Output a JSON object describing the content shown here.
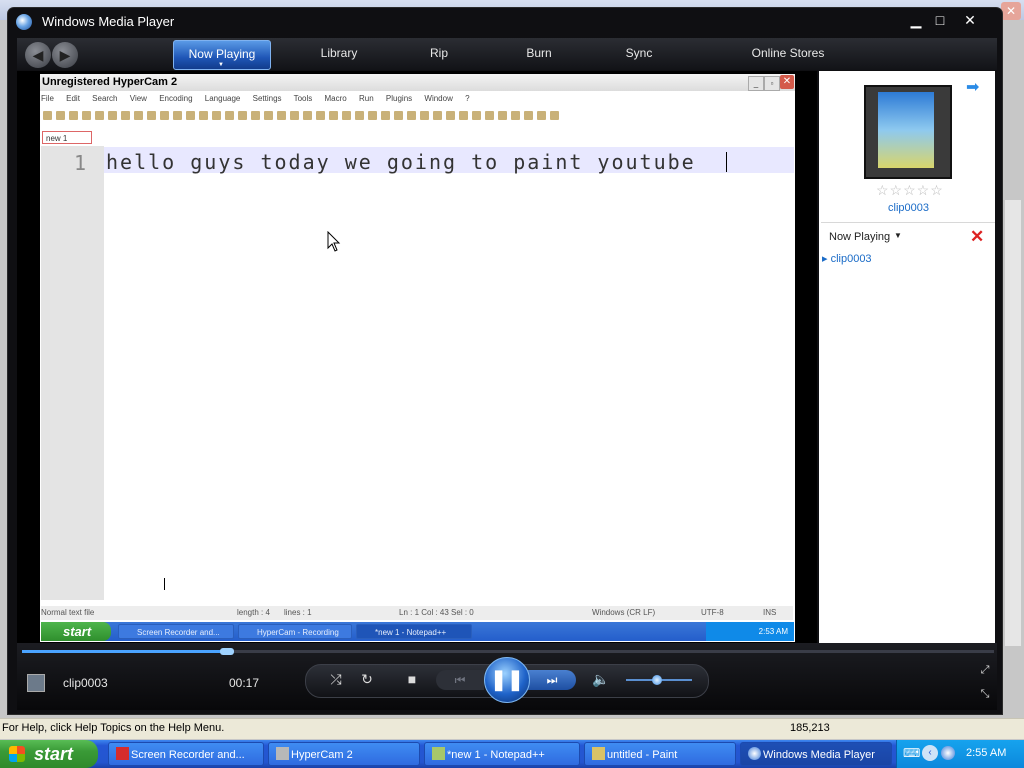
{
  "wmp": {
    "title": "Windows Media Player",
    "tabs": [
      "Now Playing",
      "Library",
      "Rip",
      "Burn",
      "Sync",
      "Online Stores"
    ]
  },
  "capture": {
    "window_title": "Unregistered HyperCam 2",
    "menu": [
      "File",
      "Edit",
      "Search",
      "View",
      "Encoding",
      "Language",
      "Settings",
      "Tools",
      "Macro",
      "Run",
      "Plugins",
      "Window",
      "?"
    ],
    "tab": "new 1",
    "line_number": "1",
    "editor_text": "hello guys today we going to paint youtube",
    "status": {
      "type": "Normal text file",
      "length": "length : 4",
      "lines": "lines : 1",
      "pos": "Ln : 1    Col : 43    Sel : 0",
      "eol": "Windows (CR LF)",
      "enc": "UTF-8",
      "ins": "INS"
    },
    "taskbar": {
      "start": "start",
      "tasks": [
        "Screen Recorder and...",
        "HyperCam - Recording",
        "*new 1 - Notepad++"
      ],
      "clock": "2:53 AM"
    }
  },
  "side": {
    "album_caption": "clip0003",
    "stars": "☆☆☆☆☆",
    "now_playing_label": "Now Playing",
    "playlist_item": "clip0003"
  },
  "player": {
    "clip_name": "clip0003",
    "time": "00:17",
    "progress": 0.21
  },
  "statusbar": {
    "help": "For Help, click Help Topics on the Help Menu.",
    "coords": "185,213"
  },
  "taskbar": {
    "start": "start",
    "tasks": [
      "Screen Recorder and...",
      "HyperCam 2",
      "*new 1 - Notepad++",
      "untitled - Paint",
      "Windows Media Player"
    ],
    "clock": "2:55 AM"
  },
  "colors": {
    "accent": "#1f56b6",
    "taskbar": "#2457d4",
    "start": "#3a9a37"
  }
}
